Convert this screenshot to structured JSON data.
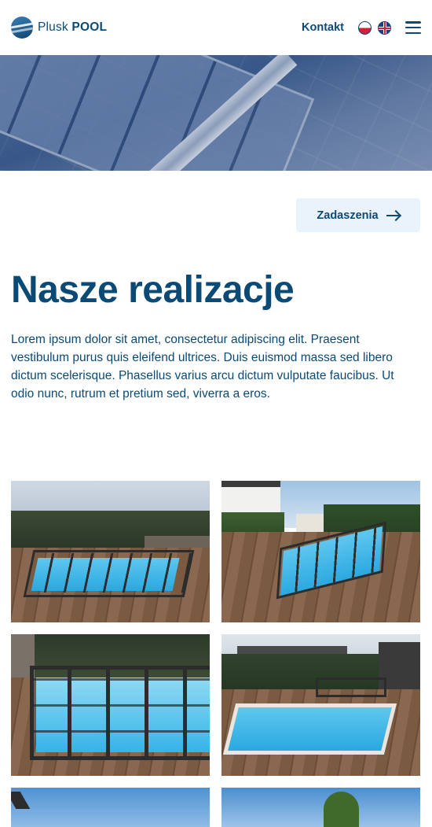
{
  "header": {
    "logo_plain": "Plusk",
    "logo_bold": "POOL",
    "contact_label": "Kontakt",
    "lang_pl_icon": "flag-pl-icon",
    "lang_en_icon": "flag-en-icon",
    "menu_icon": "hamburger-menu-icon"
  },
  "section": {
    "category_button": "Zadaszenia",
    "category_button_icon": "arrow-right-icon",
    "title": "Nasze realizacje",
    "description": "Lorem ipsum dolor sit amet, consectetur adipiscing elit. Praesent vestibulum purus quis eleifend ultrices. Duis euismod massa sed libero dictum scelerisque. Phasellus varius arcu dictum vulputate faucibus. Ut odio nunc, rutrum et pretium sed, viverra a eros."
  },
  "colors": {
    "brand": "#0b4a75",
    "button_bg": "#eaf3fb",
    "pool_water": "#2aa8e0"
  }
}
